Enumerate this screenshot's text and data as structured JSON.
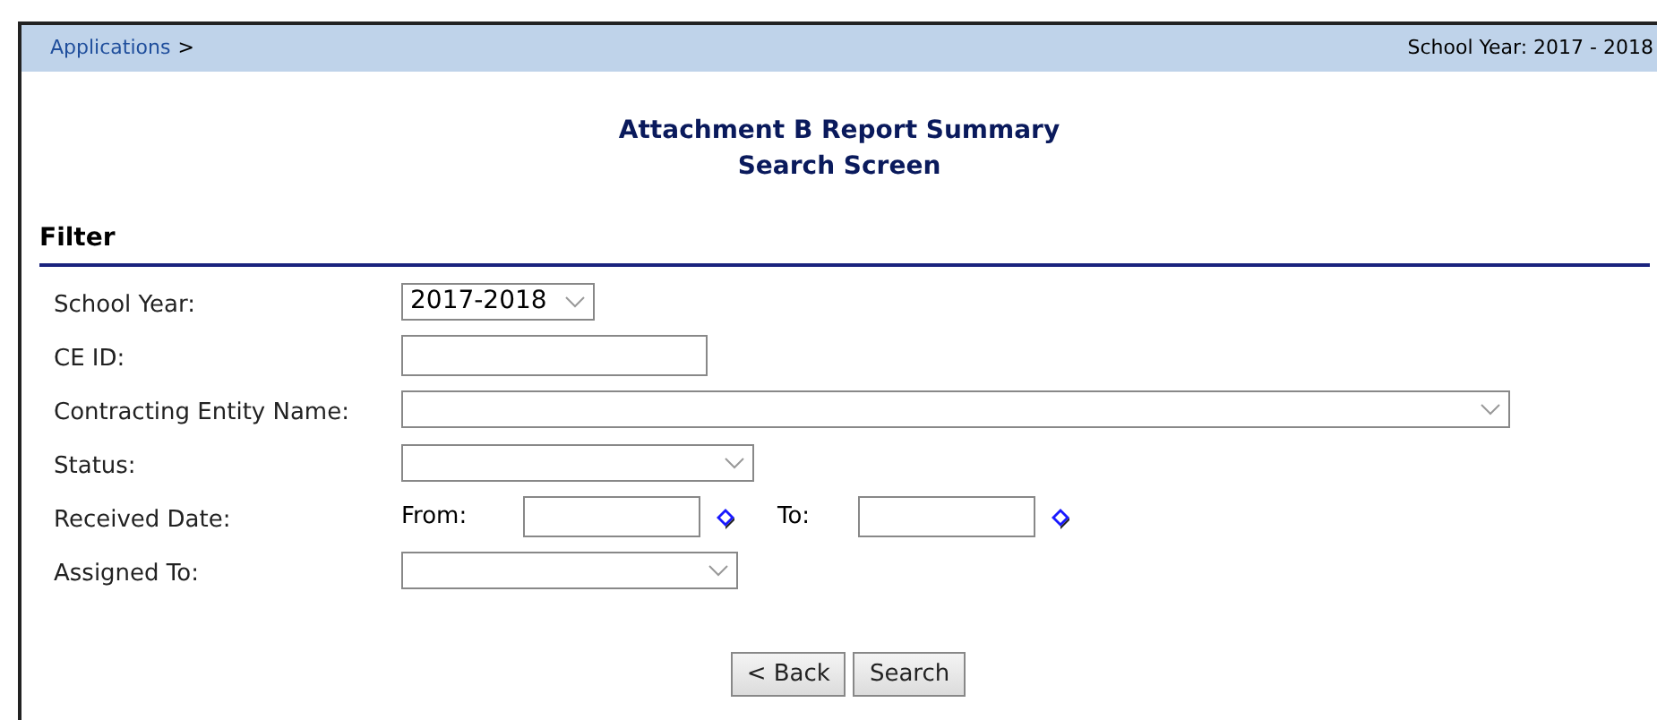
{
  "breadcrumb": {
    "link": "Applications",
    "separator": ">"
  },
  "school_year_banner": "School Year: 2017 - 2018",
  "title": [
    "Attachment B Report Summary",
    "Search Screen"
  ],
  "section": "Filter",
  "fields": [
    {
      "label": "School Year:",
      "kind": "select",
      "value": "2017-2018"
    },
    {
      "label": "CE ID:",
      "kind": "text"
    },
    {
      "label": "Contracting Entity Name:",
      "kind": "select"
    },
    {
      "label": "Status:",
      "kind": "select"
    },
    {
      "label": "Received Date:",
      "kind": "daterange",
      "from_label": "From:",
      "to_label": "To:"
    },
    {
      "label": "Assigned To:",
      "kind": "select"
    }
  ],
  "buttons": [
    "< Back",
    "Search"
  ]
}
